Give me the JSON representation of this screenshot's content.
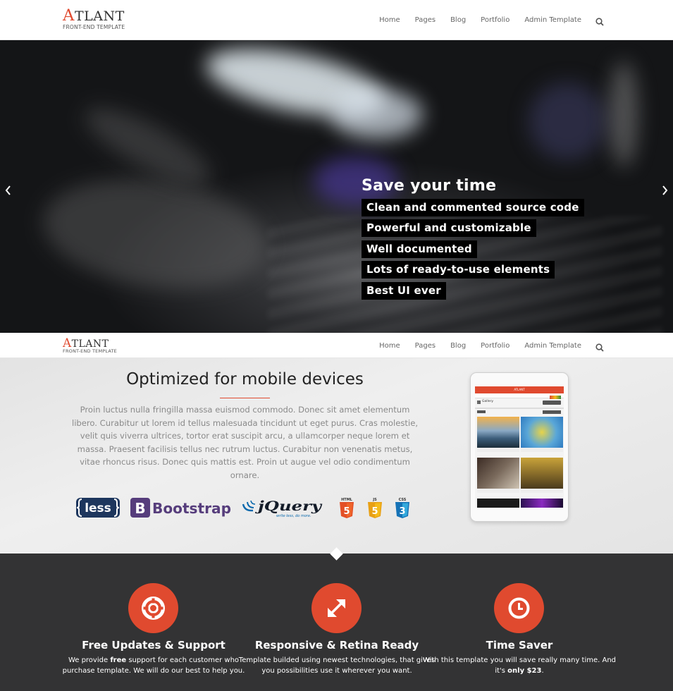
{
  "brand": {
    "logo_initial": "A",
    "logo_rest": "TLANT",
    "tagline": "FRONT-END TEMPLATE",
    "accent_color": "#e04a2f"
  },
  "nav": {
    "items": [
      "Home",
      "Pages",
      "Blog",
      "Portfolio",
      "Admin Template"
    ],
    "search_icon": "search-icon"
  },
  "hero": {
    "title": "Save your time",
    "features": [
      "Clean and commented source code",
      "Powerful and customizable",
      "Well documented",
      "Lots of ready-to-use elements",
      "Best UI ever"
    ],
    "prev_icon": "chevron-left-icon",
    "next_icon": "chevron-right-icon"
  },
  "mobile": {
    "title": "Optimized for mobile devices",
    "text": "Proin luctus nulla fringilla massa euismod commodo. Donec sit amet elementum libero. Curabitur ut lorem id tellus malesuada tincidunt ut eget purus. Cras molestie, velit quis viverra ultrices, tortor erat suscipit arcu, a ullamcorper neque lorem et massa. Praesent facilisis tellus nec rutrum luctus. Curabitur non venenatis metus, vitae rhoncus risus. Donec quis mattis est. Proin ut augue vel odio condimentum ornare.",
    "tech": {
      "less": "less",
      "bootstrap_letter": "B",
      "bootstrap": "Bootstrap",
      "jquery": "jQuery",
      "jquery_tag": "write less, do more.",
      "html": "HTML",
      "js": "JS",
      "css": "CSS"
    },
    "tablet": {
      "app_title": "ATLANT",
      "gallery_label": "Gallery"
    }
  },
  "features": [
    {
      "icon": "lifebuoy-icon",
      "title": "Free Updates & Support",
      "desc_before": "We provide ",
      "desc_bold": "free",
      "desc_after": " support for each customer who purchase template. We will do our best to help you."
    },
    {
      "icon": "expand-arrows-icon",
      "title": "Responsive & Retina Ready",
      "desc_before": "Template builded using newest technologies, that gives you possibilities use it wherever you want.",
      "desc_bold": "",
      "desc_after": ""
    },
    {
      "icon": "clock-icon",
      "title": "Time Saver",
      "desc_before": "With this template you will save really many time. And it's ",
      "desc_bold": "only $23",
      "desc_after": "."
    }
  ]
}
